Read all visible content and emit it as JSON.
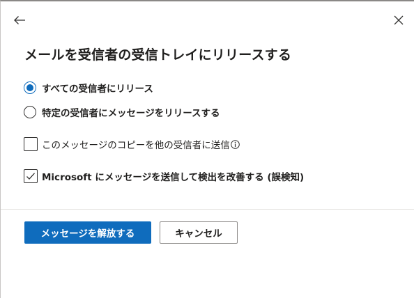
{
  "dialog": {
    "title": "メールを受信者の受信トレイにリリースする"
  },
  "options": {
    "release_all": {
      "label": "すべての受信者にリリース",
      "checked": true
    },
    "release_specific": {
      "label": "特定の受信者にメッセージをリリースする",
      "checked": false
    }
  },
  "checkboxes": {
    "send_copy": {
      "label": "このメッセージのコピーを他の受信者に送信",
      "checked": false
    },
    "improve_detection": {
      "label": "Microsoft にメッセージを送信して検出を改善する (誤検知)",
      "checked": true
    }
  },
  "buttons": {
    "release_label": "メッセージを解放する",
    "cancel_label": "キャンセル"
  },
  "icons": {
    "back": "back-arrow-icon",
    "close": "close-icon",
    "info": "info-icon",
    "check": "checkmark-icon"
  },
  "colors": {
    "accent": "#0f6cbd",
    "text": "#201f1e",
    "border": "#8a8886"
  }
}
